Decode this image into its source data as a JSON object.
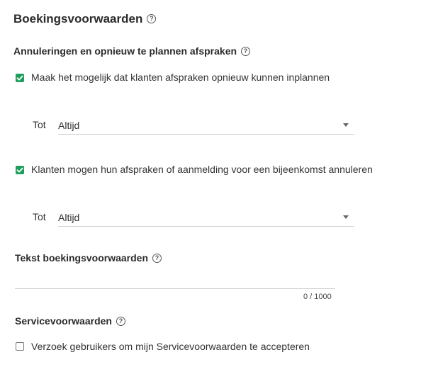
{
  "booking": {
    "title": "Boekingsvoorwaarden",
    "help_icon": "?"
  },
  "cancellations": {
    "title": "Annuleringen en opnieuw te plannen afspraken",
    "help_icon": "?",
    "reschedule": {
      "checked": true,
      "label": "Maak het mogelijk dat klanten afspraken opnieuw kunnen inplannen",
      "until_label": "Tot",
      "until_value": "Altijd"
    },
    "cancel": {
      "checked": true,
      "label": "Klanten mogen hun afspraken of aanmelding voor een bijeenkomst annuleren",
      "until_label": "Tot",
      "until_value": "Altijd"
    }
  },
  "terms_text": {
    "title": "Tekst boekingsvoorwaarden",
    "help_icon": "?",
    "value": "",
    "counter": "0 / 1000"
  },
  "service_terms": {
    "title": "Servicevoorwaarden",
    "help_icon": "?",
    "checkbox_checked": false,
    "checkbox_label": "Verzoek gebruikers om mijn Servicevoorwaarden te accepteren"
  },
  "colors": {
    "accent": "#1e9e5a"
  }
}
